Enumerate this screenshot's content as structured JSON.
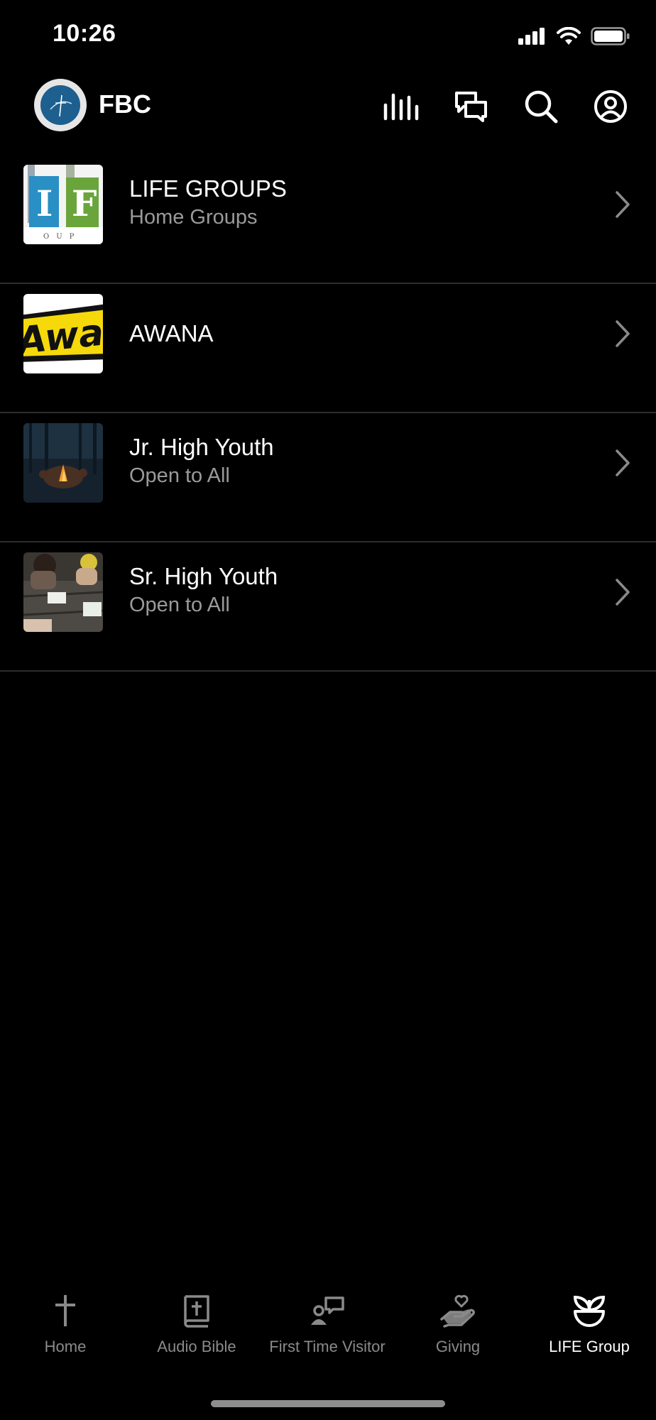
{
  "status_bar": {
    "time": "10:26"
  },
  "header": {
    "app_title": "FBC"
  },
  "groups": [
    {
      "title": "LIFE GROUPS",
      "subtitle": "Home Groups",
      "thumbnail": "life-groups-logo"
    },
    {
      "title": "AWANA",
      "subtitle": "",
      "thumbnail": "awana-logo"
    },
    {
      "title": "Jr. High Youth",
      "subtitle": "Open to All",
      "thumbnail": "campfire-photo"
    },
    {
      "title": "Sr. High Youth",
      "subtitle": "Open to All",
      "thumbnail": "bible-study-photo"
    }
  ],
  "tabs": [
    {
      "label": "Home",
      "icon": "cross-icon",
      "active": false
    },
    {
      "label": "Audio Bible",
      "icon": "bible-icon",
      "active": false
    },
    {
      "label": "First Time Visitor",
      "icon": "visitor-icon",
      "active": false
    },
    {
      "label": "Giving",
      "icon": "giving-icon",
      "active": false
    },
    {
      "label": "LIFE Group",
      "icon": "plant-icon",
      "active": true
    }
  ],
  "colors": {
    "background": "#000000",
    "text": "#ffffff",
    "muted": "#9a9a9a",
    "separator": "#2d2d2d"
  }
}
